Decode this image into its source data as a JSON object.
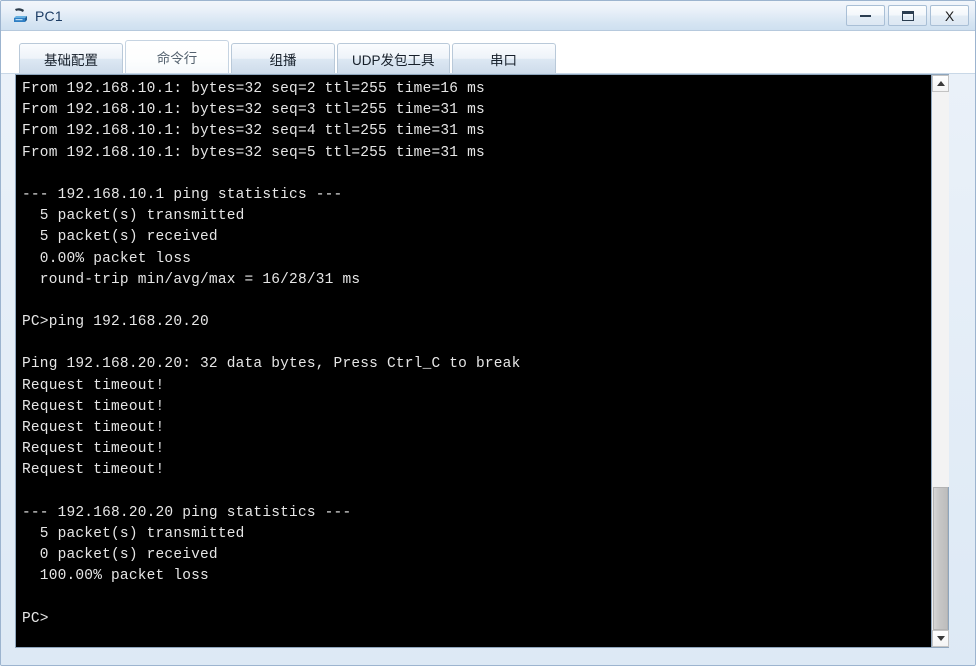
{
  "window": {
    "title": "PC1",
    "icon": "pc-device-icon",
    "buttons": [
      {
        "name": "minimize",
        "label": "—"
      },
      {
        "name": "maximize",
        "label": "□"
      },
      {
        "name": "close",
        "label": "X"
      }
    ]
  },
  "tabs": [
    {
      "label": "基础配置",
      "active": false
    },
    {
      "label": "命令行",
      "active": true
    },
    {
      "label": "组播",
      "active": false
    },
    {
      "label": "UDP发包工具",
      "active": false
    },
    {
      "label": "串口",
      "active": false
    }
  ],
  "terminal": {
    "fg_color": "#e6e6e6",
    "bg_color": "#000000",
    "lines": [
      "From 192.168.10.1: bytes=32 seq=2 ttl=255 time=16 ms",
      "From 192.168.10.1: bytes=32 seq=3 ttl=255 time=31 ms",
      "From 192.168.10.1: bytes=32 seq=4 ttl=255 time=31 ms",
      "From 192.168.10.1: bytes=32 seq=5 ttl=255 time=31 ms",
      "",
      "--- 192.168.10.1 ping statistics ---",
      "  5 packet(s) transmitted",
      "  5 packet(s) received",
      "  0.00% packet loss",
      "  round-trip min/avg/max = 16/28/31 ms",
      "",
      "PC>ping 192.168.20.20",
      "",
      "Ping 192.168.20.20: 32 data bytes, Press Ctrl_C to break",
      "Request timeout!",
      "Request timeout!",
      "Request timeout!",
      "Request timeout!",
      "Request timeout!",
      "",
      "--- 192.168.20.20 ping statistics ---",
      "  5 packet(s) transmitted",
      "  0 packet(s) received",
      "  100.00% packet loss",
      "",
      "PC>"
    ]
  },
  "scrollbar": {
    "up_arrow": "scroll-up",
    "down_arrow": "scroll-down",
    "thumb_position_percent": 92
  }
}
